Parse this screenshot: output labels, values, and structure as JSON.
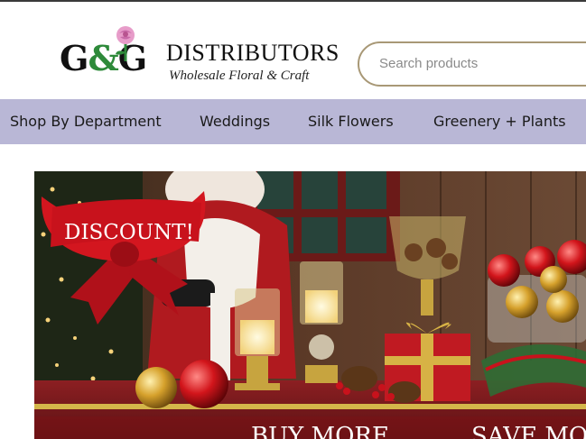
{
  "brand": {
    "mark": "G&G",
    "mark_g1": "G",
    "mark_amp": "&",
    "mark_g2": "G",
    "name": "DISTRIBUTORS",
    "tagline": "Wholesale Floral & Craft"
  },
  "search": {
    "placeholder": "Search products"
  },
  "nav": {
    "items": [
      {
        "label": "Shop By Department"
      },
      {
        "label": "Weddings"
      },
      {
        "label": "Silk Flowers"
      },
      {
        "label": "Greenery + Plants"
      }
    ]
  },
  "hero": {
    "ribbon_text": "DISCOUNT!",
    "banner_left": "BUY MORE",
    "banner_right": "SAVE MO"
  },
  "colors": {
    "nav_bg": "#b9b7d6",
    "search_border": "#a89876",
    "logo_green": "#2e8a3a",
    "ribbon_red": "#c8121c"
  },
  "icons": {
    "logo_flower": "rose-icon"
  }
}
